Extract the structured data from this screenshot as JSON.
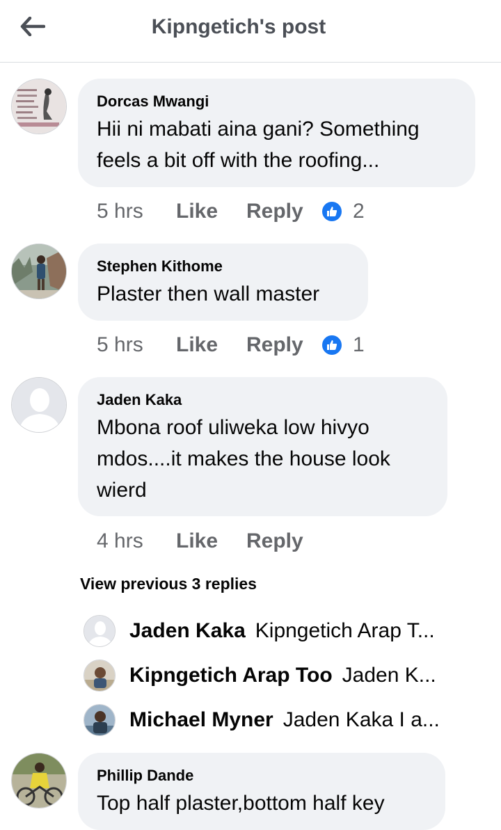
{
  "header": {
    "back_icon": "arrow-left-icon",
    "title": "Kipngetich's post"
  },
  "comments": [
    {
      "author": "Dorcas Mwangi",
      "lines": [
        "Hii ni mabati aina gani? Something",
        "feels a bit off with the roofing..."
      ],
      "time": "5 hrs",
      "like_label": "Like",
      "reply_label": "Reply",
      "reaction_count": "2"
    },
    {
      "author": "Stephen Kithome",
      "lines": [
        "Plaster then wall master"
      ],
      "time": "5 hrs",
      "like_label": "Like",
      "reply_label": "Reply",
      "reaction_count": "1"
    },
    {
      "author": "Jaden Kaka",
      "lines": [
        "Mbona roof uliweka low hivyo",
        "mdos....it makes the house look",
        "wierd"
      ],
      "time": "4 hrs",
      "like_label": "Like",
      "reply_label": "Reply"
    },
    {
      "author": "Phillip Dande",
      "lines": [
        "Top half plaster,bottom half key"
      ]
    }
  ],
  "view_previous": "View previous 3 replies",
  "replies": [
    {
      "name": "Jaden Kaka",
      "snippet": "Kipngetich Arap T..."
    },
    {
      "name": "Kipngetich Arap Too",
      "snippet": "Jaden K..."
    },
    {
      "name": "Michael Myner",
      "snippet": "Jaden Kaka I a..."
    }
  ],
  "colors": {
    "bubble_bg": "#f0f2f5",
    "secondary_text": "#65676b",
    "like_blue": "#1877f2"
  }
}
